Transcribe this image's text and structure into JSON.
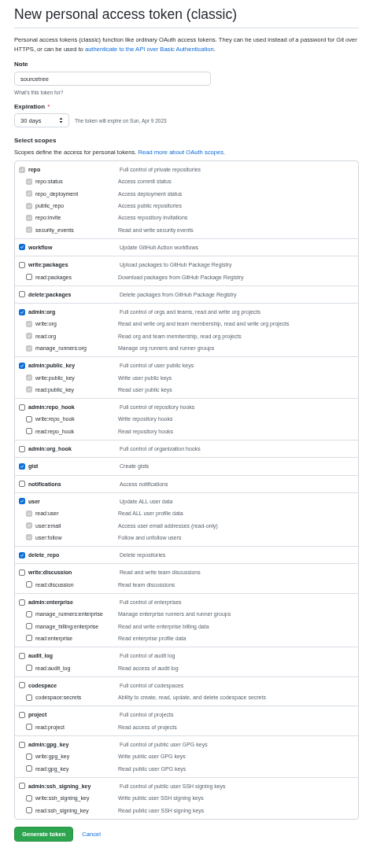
{
  "title": "New personal access token (classic)",
  "intro": {
    "text": "Personal access tokens (classic) function like ordinary OAuth access tokens. They can be used instead of a password for Git over HTTPS, or can be used to ",
    "link": "authenticate to the API over Basic Authentication",
    "end": "."
  },
  "note": {
    "label": "Note",
    "value": "sourcetree",
    "hint": "What's this token for?"
  },
  "expiration": {
    "label": "Expiration",
    "required_mark": "*",
    "value": "30 days",
    "info": "The token will expire on Sun, Apr 9 2023"
  },
  "scopes_heading": "Select scopes",
  "scopes_intro": {
    "text": "Scopes define the access for personal tokens. ",
    "link": "Read more about OAuth scopes."
  },
  "scopes": [
    {
      "name": "repo",
      "description": "Full control of private repositories",
      "checked": true,
      "disabled": true,
      "children": [
        {
          "name": "repo:status",
          "description": "Access commit status",
          "checked": true,
          "disabled": true
        },
        {
          "name": "repo_deployment",
          "description": "Access deployment status",
          "checked": true,
          "disabled": true
        },
        {
          "name": "public_repo",
          "description": "Access public repositories",
          "checked": true,
          "disabled": true
        },
        {
          "name": "repo:invite",
          "description": "Access repository invitations",
          "checked": true,
          "disabled": true
        },
        {
          "name": "security_events",
          "description": "Read and write security events",
          "checked": true,
          "disabled": true
        }
      ]
    },
    {
      "name": "workflow",
      "description": "Update GitHub Action workflows",
      "checked": true,
      "disabled": false
    },
    {
      "name": "write:packages",
      "description": "Upload packages to GitHub Package Registry",
      "checked": false,
      "disabled": false,
      "children": [
        {
          "name": "read:packages",
          "description": "Download packages from GitHub Package Registry",
          "checked": false,
          "disabled": false
        }
      ]
    },
    {
      "name": "delete:packages",
      "description": "Delete packages from GitHub Package Registry",
      "checked": false,
      "disabled": false
    },
    {
      "name": "admin:org",
      "description": "Full control of orgs and teams, read and write org projects",
      "checked": true,
      "disabled": false,
      "children": [
        {
          "name": "write:org",
          "description": "Read and write org and team membership, read and write org projects",
          "checked": true,
          "disabled": true
        },
        {
          "name": "read:org",
          "description": "Read org and team membership, read org projects",
          "checked": true,
          "disabled": true
        },
        {
          "name": "manage_runners:org",
          "description": "Manage org runners and runner groups",
          "checked": true,
          "disabled": true
        }
      ]
    },
    {
      "name": "admin:public_key",
      "description": "Full control of user public keys",
      "checked": true,
      "disabled": false,
      "children": [
        {
          "name": "write:public_key",
          "description": "Write user public keys",
          "checked": true,
          "disabled": true
        },
        {
          "name": "read:public_key",
          "description": "Read user public keys",
          "checked": true,
          "disabled": true
        }
      ]
    },
    {
      "name": "admin:repo_hook",
      "description": "Full control of repository hooks",
      "checked": false,
      "disabled": false,
      "children": [
        {
          "name": "write:repo_hook",
          "description": "Write repository hooks",
          "checked": false,
          "disabled": false
        },
        {
          "name": "read:repo_hook",
          "description": "Read repository hooks",
          "checked": false,
          "disabled": false
        }
      ]
    },
    {
      "name": "admin:org_hook",
      "description": "Full control of organization hooks",
      "checked": false,
      "disabled": false
    },
    {
      "name": "gist",
      "description": "Create gists",
      "checked": true,
      "disabled": false
    },
    {
      "name": "notifications",
      "description": "Access notifications",
      "checked": false,
      "disabled": false
    },
    {
      "name": "user",
      "description": "Update ALL user data",
      "checked": true,
      "disabled": false,
      "children": [
        {
          "name": "read:user",
          "description": "Read ALL user profile data",
          "checked": true,
          "disabled": true
        },
        {
          "name": "user:email",
          "description": "Access user email addresses (read-only)",
          "checked": true,
          "disabled": true
        },
        {
          "name": "user:follow",
          "description": "Follow and unfollow users",
          "checked": true,
          "disabled": true
        }
      ]
    },
    {
      "name": "delete_repo",
      "description": "Delete repositories",
      "checked": true,
      "disabled": false
    },
    {
      "name": "write:discussion",
      "description": "Read and write team discussions",
      "checked": false,
      "disabled": false,
      "children": [
        {
          "name": "read:discussion",
          "description": "Read team discussions",
          "checked": false,
          "disabled": false
        }
      ]
    },
    {
      "name": "admin:enterprise",
      "description": "Full control of enterprises",
      "checked": false,
      "disabled": false,
      "children": [
        {
          "name": "manage_runners:enterprise",
          "description": "Manage enterprise runners and runner groups",
          "checked": false,
          "disabled": false
        },
        {
          "name": "manage_billing:enterprise",
          "description": "Read and write enterprise billing data",
          "checked": false,
          "disabled": false
        },
        {
          "name": "read:enterprise",
          "description": "Read enterprise profile data",
          "checked": false,
          "disabled": false
        }
      ]
    },
    {
      "name": "audit_log",
      "description": "Full control of audit log",
      "checked": false,
      "disabled": false,
      "children": [
        {
          "name": "read:audit_log",
          "description": "Read access of audit log",
          "checked": false,
          "disabled": false
        }
      ]
    },
    {
      "name": "codespace",
      "description": "Full control of codespaces",
      "checked": false,
      "disabled": false,
      "children": [
        {
          "name": "codespace:secrets",
          "description": "Ability to create, read, update, and delete codespace secrets",
          "checked": false,
          "disabled": false
        }
      ]
    },
    {
      "name": "project",
      "description": "Full control of projects",
      "checked": false,
      "disabled": false,
      "children": [
        {
          "name": "read:project",
          "description": "Read access of projects",
          "checked": false,
          "disabled": false
        }
      ]
    },
    {
      "name": "admin:gpg_key",
      "description": "Full control of public user GPG keys",
      "checked": false,
      "disabled": false,
      "children": [
        {
          "name": "write:gpg_key",
          "description": "Write public user GPG keys",
          "checked": false,
          "disabled": false
        },
        {
          "name": "read:gpg_key",
          "description": "Read public user GPG keys",
          "checked": false,
          "disabled": false
        }
      ]
    },
    {
      "name": "admin:ssh_signing_key",
      "description": "Full control of public user SSH signing keys",
      "checked": false,
      "disabled": false,
      "children": [
        {
          "name": "write:ssh_signing_key",
          "description": "Write public user SSH signing keys",
          "checked": false,
          "disabled": false
        },
        {
          "name": "read:ssh_signing_key",
          "description": "Read public user SSH signing keys",
          "checked": false,
          "disabled": false
        }
      ]
    }
  ],
  "buttons": {
    "primary": "Generate token",
    "cancel": "Cancel"
  }
}
